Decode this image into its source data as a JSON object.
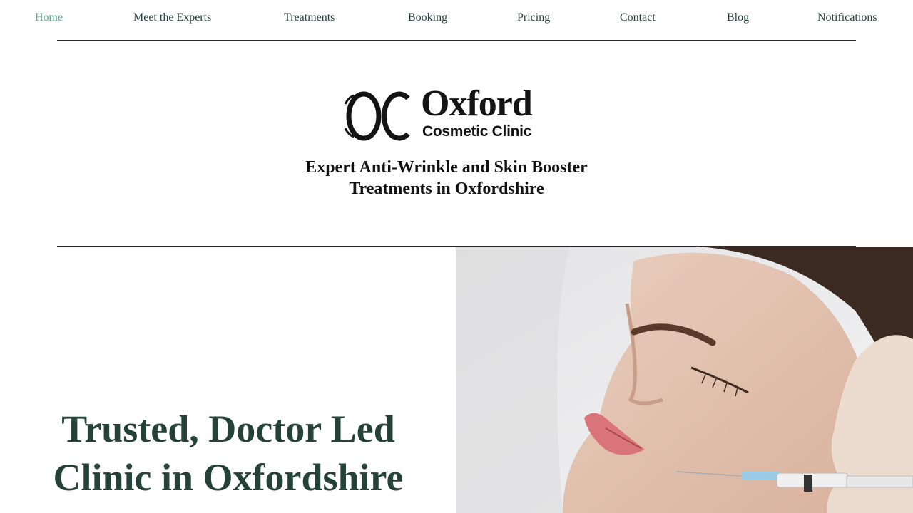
{
  "nav": {
    "items": [
      {
        "label": "Home",
        "active": true
      },
      {
        "label": "Meet the Experts",
        "active": false
      },
      {
        "label": "Treatments",
        "active": false
      },
      {
        "label": "Booking",
        "active": false
      },
      {
        "label": "Pricing",
        "active": false
      },
      {
        "label": "Contact",
        "active": false
      },
      {
        "label": "Blog",
        "active": false
      },
      {
        "label": "Notifications",
        "active": false
      }
    ]
  },
  "logo": {
    "icon": "interlocking-oc-monogram-icon",
    "name": "Oxford",
    "subtitle": "Cosmetic Clinic"
  },
  "tagline": {
    "line1": "Expert Anti-Wrinkle and Skin Booster",
    "line2": "Treatments in Oxfordshire"
  },
  "hero": {
    "heading_line1": "Trusted, Doctor Led",
    "heading_line2": "Clinic in Oxfordshire",
    "image": "woman-receiving-injection-photo"
  },
  "colors": {
    "nav_text": "#1f3d36",
    "nav_active": "#5fa58a",
    "heading": "#244238",
    "rule": "#2a2a2a"
  }
}
